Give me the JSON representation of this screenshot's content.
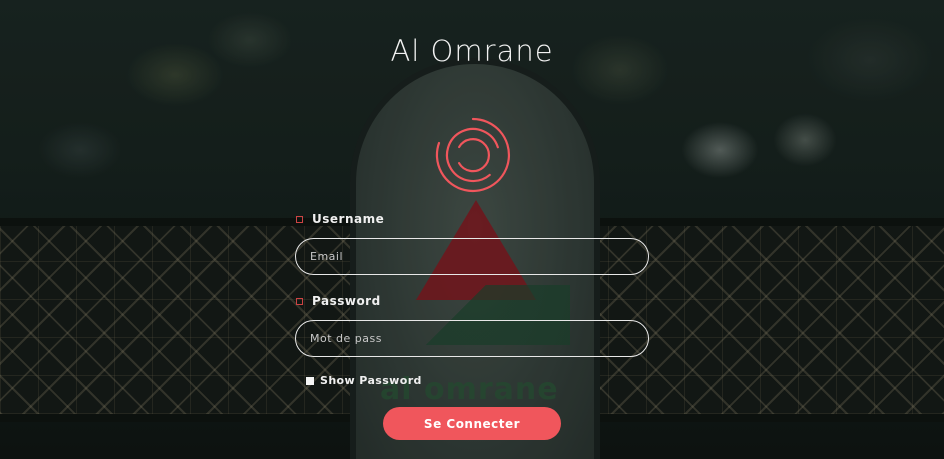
{
  "page": {
    "title": "Al Omrane"
  },
  "background": {
    "logo_text": "al omrane"
  },
  "colors": {
    "accent": "#f0565c",
    "spinner": "#f0565c",
    "text": "#f2f2f2"
  },
  "form": {
    "username": {
      "label": "Username",
      "icon": "user-icon",
      "placeholder": "Email",
      "value": ""
    },
    "password": {
      "label": "Password",
      "icon": "lock-icon",
      "placeholder": "Mot de pass",
      "value": ""
    },
    "show_password": {
      "label": "Show Password",
      "checked": false
    },
    "submit_label": "Se Connecter"
  }
}
